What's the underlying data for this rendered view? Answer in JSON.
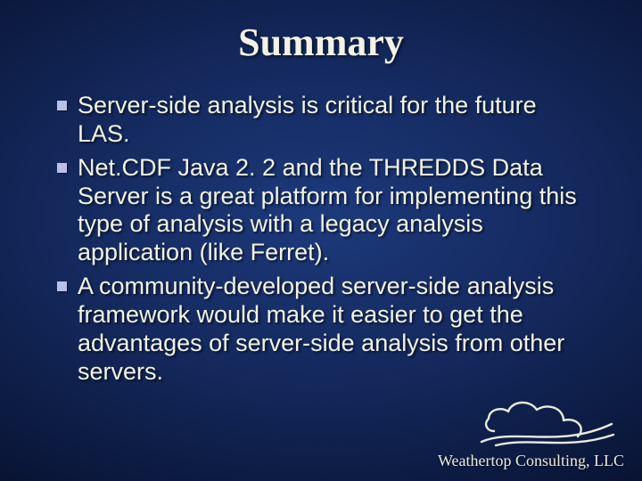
{
  "title": "Summary",
  "bullets": [
    "Server-side analysis is critical for the future LAS.",
    "Net.CDF Java 2. 2 and the THREDDS Data Server is a great platform for implementing this type of analysis with a legacy analysis application (like Ferret).",
    "A community-developed server-side analysis framework would make it easier to get the advantages of server-side analysis from other servers."
  ],
  "footer": "Weathertop Consulting, LLC"
}
